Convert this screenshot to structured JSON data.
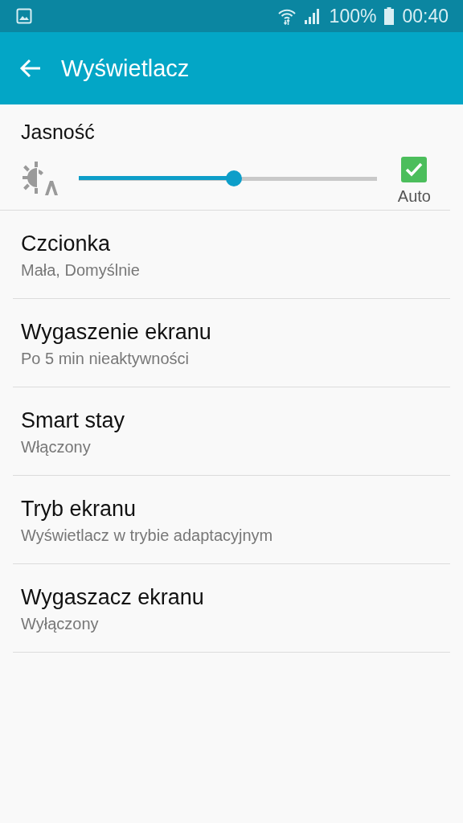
{
  "status_bar": {
    "battery": "100%",
    "time": "00:40"
  },
  "app_bar": {
    "title": "Wyświetlacz"
  },
  "brightness": {
    "title": "Jasność",
    "level": 0.52,
    "auto_label": "Auto",
    "auto_checked": true
  },
  "settings": [
    {
      "title": "Czcionka",
      "subtitle": "Mała, Domyślnie"
    },
    {
      "title": "Wygaszenie ekranu",
      "subtitle": "Po 5 min nieaktywności"
    },
    {
      "title": "Smart stay",
      "subtitle": "Włączony"
    },
    {
      "title": "Tryb ekranu",
      "subtitle": "Wyświetlacz w trybie adaptacyjnym"
    },
    {
      "title": "Wygaszacz ekranu",
      "subtitle": "Wyłączony"
    }
  ]
}
